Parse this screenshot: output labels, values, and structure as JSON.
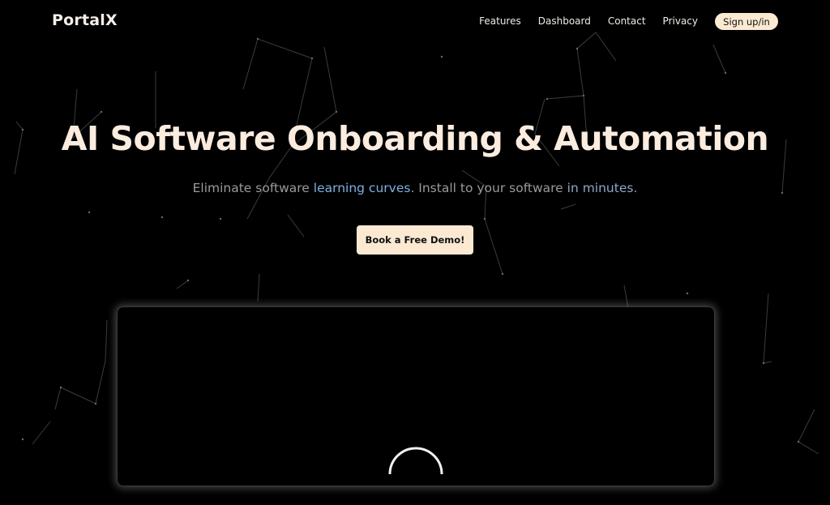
{
  "nav": {
    "logo": "PortalX",
    "items": [
      {
        "label": "Features"
      },
      {
        "label": "Dashboard"
      },
      {
        "label": "Contact"
      },
      {
        "label": "Privacy"
      }
    ],
    "signin_label": "Sign up/in"
  },
  "hero": {
    "title": "AI Software Onboarding & Automation",
    "subtitle": {
      "part1": "Eliminate software ",
      "highlight1": "learning curves",
      "part2": ". Install to your software ",
      "highlight2": "in minutes",
      "part3": "."
    },
    "cta_label": "Book a Free Demo!"
  },
  "icons": {
    "loading": "loading-spinner-icon"
  },
  "colors": {
    "background": "#000000",
    "accent_cream": "#fbe9d2",
    "highlight_blue": "#7fb0e0"
  }
}
